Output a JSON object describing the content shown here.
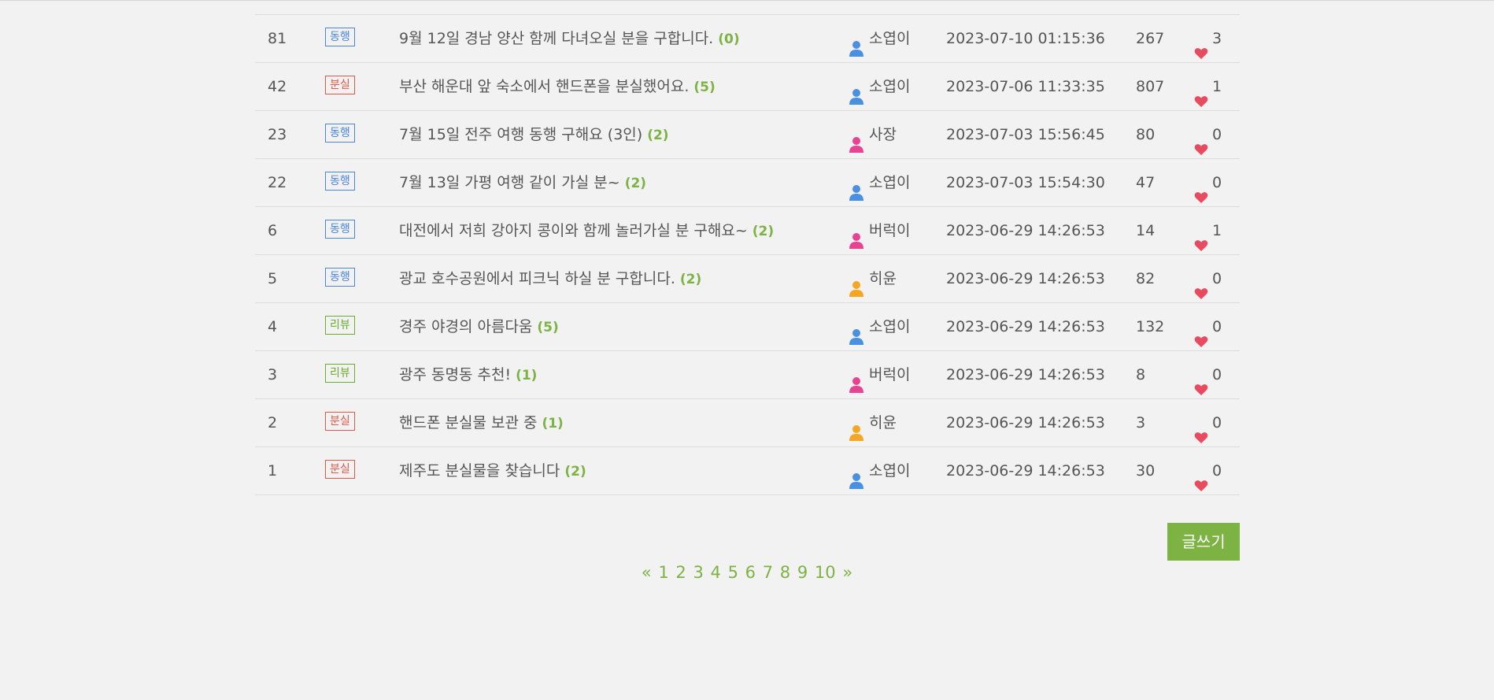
{
  "colors": {
    "background": "#f2f2f2",
    "accent": "#7cb342",
    "badge_companion": "#4a86d8",
    "badge_lost": "#e0574a",
    "badge_review": "#6aad2e",
    "heart": "#e84a5f",
    "avatar_blue": "#4a90e2",
    "avatar_pink": "#e84393",
    "avatar_orange": "#f5a623"
  },
  "posts": [
    {
      "no": "81",
      "category": "동행",
      "category_style": "blue",
      "title": "9월 12일 경남 양산 함께 다녀오실 분을 구합니다.",
      "comments": "(0)",
      "author": "소엽이",
      "author_icon": "user-blue-icon",
      "date": "2023-07-10 01:15:36",
      "views": "267",
      "likes": "3"
    },
    {
      "no": "42",
      "category": "분실",
      "category_style": "red",
      "title": "부산 해운대 앞 숙소에서 핸드폰을 분실했어요.",
      "comments": "(5)",
      "author": "소엽이",
      "author_icon": "user-blue-icon",
      "date": "2023-07-06 11:33:35",
      "views": "807",
      "likes": "1"
    },
    {
      "no": "23",
      "category": "동행",
      "category_style": "blue",
      "title": "7월 15일 전주 여행 동행 구해요 (3인)",
      "comments": "(2)",
      "author": "사장",
      "author_icon": "user-pink-icon",
      "date": "2023-07-03 15:56:45",
      "views": "80",
      "likes": "0"
    },
    {
      "no": "22",
      "category": "동행",
      "category_style": "blue",
      "title": "7월 13일 가평 여행 같이 가실 분~",
      "comments": "(2)",
      "author": "소엽이",
      "author_icon": "user-blue-icon",
      "date": "2023-07-03 15:54:30",
      "views": "47",
      "likes": "0"
    },
    {
      "no": "6",
      "category": "동행",
      "category_style": "blue",
      "title": "대전에서 저희 강아지 콩이와 함께 놀러가실 분 구해요~",
      "comments": "(2)",
      "author": "버럭이",
      "author_icon": "user-pink-icon",
      "date": "2023-06-29 14:26:53",
      "views": "14",
      "likes": "1"
    },
    {
      "no": "5",
      "category": "동행",
      "category_style": "blue",
      "title": "광교 호수공원에서 피크닉 하실 분 구합니다.",
      "comments": "(2)",
      "author": "히윤",
      "author_icon": "user-orange-icon",
      "date": "2023-06-29 14:26:53",
      "views": "82",
      "likes": "0"
    },
    {
      "no": "4",
      "category": "리뷰",
      "category_style": "green",
      "title": "경주 야경의 아름다움",
      "comments": "(5)",
      "author": "소엽이",
      "author_icon": "user-blue-icon",
      "date": "2023-06-29 14:26:53",
      "views": "132",
      "likes": "0"
    },
    {
      "no": "3",
      "category": "리뷰",
      "category_style": "green",
      "title": "광주 동명동 추천!",
      "comments": "(1)",
      "author": "버럭이",
      "author_icon": "user-pink-icon",
      "date": "2023-06-29 14:26:53",
      "views": "8",
      "likes": "0"
    },
    {
      "no": "2",
      "category": "분실",
      "category_style": "red",
      "title": "핸드폰 분실물 보관 중",
      "comments": "(1)",
      "author": "히윤",
      "author_icon": "user-orange-icon",
      "date": "2023-06-29 14:26:53",
      "views": "3",
      "likes": "0"
    },
    {
      "no": "1",
      "category": "분실",
      "category_style": "red",
      "title": "제주도 분실물을 찾습니다",
      "comments": "(2)",
      "author": "소엽이",
      "author_icon": "user-blue-icon",
      "date": "2023-06-29 14:26:53",
      "views": "30",
      "likes": "0"
    }
  ],
  "write_button": "글쓰기",
  "pagination": {
    "prev": "«",
    "pages": [
      "1",
      "2",
      "3",
      "4",
      "5",
      "6",
      "7",
      "8",
      "9",
      "10"
    ],
    "next": "»"
  }
}
